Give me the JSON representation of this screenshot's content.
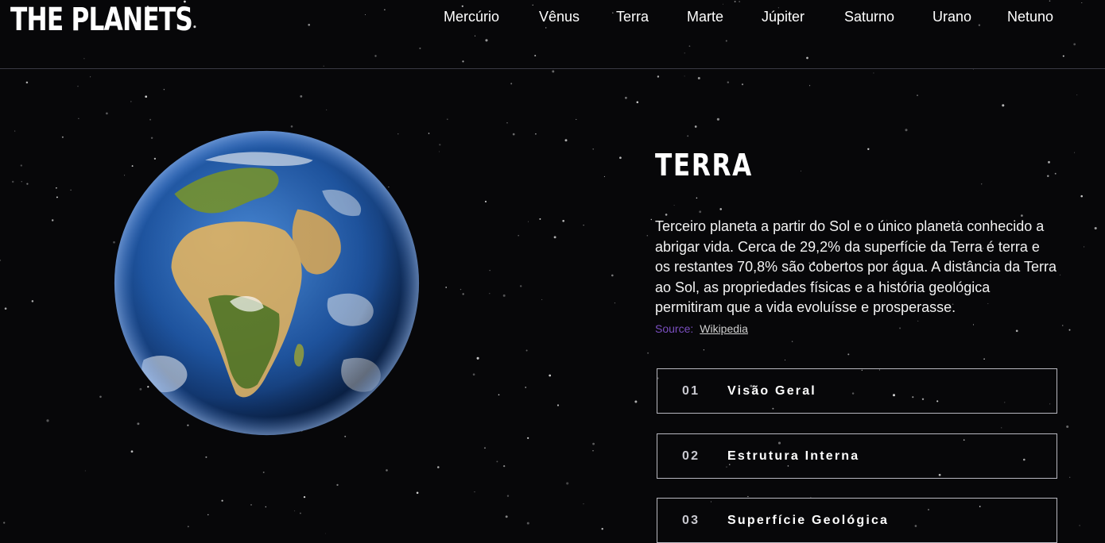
{
  "header": {
    "logo": "THE PLANETS",
    "nav": [
      "Mercúrio",
      "Vênus",
      "Terra",
      "Marte",
      "Júpiter",
      "Saturno",
      "Urano",
      "Netuno"
    ]
  },
  "planet": {
    "name": "TERRA",
    "description": "Terceiro planeta a partir do Sol e o único planeta conhecido a abrigar vida. Cerca de 29,2% da superfície da Terra é terra e os restantes 70,8% são cobertos por água. A distância da Terra ao Sol, as propriedades físicas e a história geológica permitiram que a vida evoluísse e prosperasse.",
    "source_label": "Source:",
    "source_link": "Wikipedia",
    "image_icon": "earth-globe"
  },
  "tabs": [
    {
      "number": "01",
      "label": "Visão Geral"
    },
    {
      "number": "02",
      "label": "Estrutura Interna"
    },
    {
      "number": "03",
      "label": "Superfície Geológica"
    }
  ],
  "colors": {
    "background": "#070709",
    "accent": "#7a4fc0",
    "border": "#b8b8c0",
    "ocean": "#2a64b0",
    "land": "#c9a464"
  }
}
